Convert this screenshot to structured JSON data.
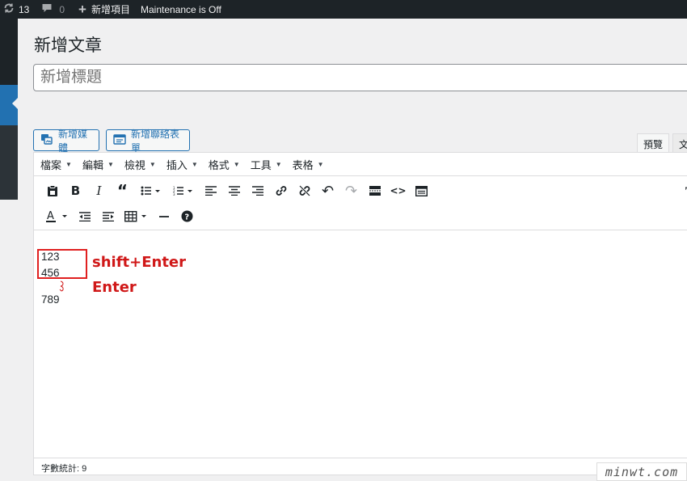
{
  "adminbar": {
    "updates_count": "13",
    "comments_count": "0",
    "new_item": "新增項目",
    "maintenance": "Maintenance is Off"
  },
  "page": {
    "title": "新增文章",
    "post_title_placeholder": "新增標題"
  },
  "media_buttons": {
    "add_media": "新增媒體",
    "add_form": "新增聯絡表單"
  },
  "editor_tabs": {
    "visual": "預覽",
    "text": "文"
  },
  "menubar": {
    "items": [
      "檔案",
      "編輯",
      "檢視",
      "插入",
      "格式",
      "工具",
      "表格"
    ]
  },
  "content": {
    "line1": "123",
    "line2": "456",
    "line3": "789",
    "annotation_shift": "shift+Enter",
    "annotation_enter": "Enter"
  },
  "statusbar": {
    "word_count": "字數統計: 9"
  },
  "watermark": "minwt.com",
  "colors": {
    "adminbar_bg": "#1d2327",
    "accent_blue": "#2271b1",
    "annotation_red": "#d01818"
  }
}
